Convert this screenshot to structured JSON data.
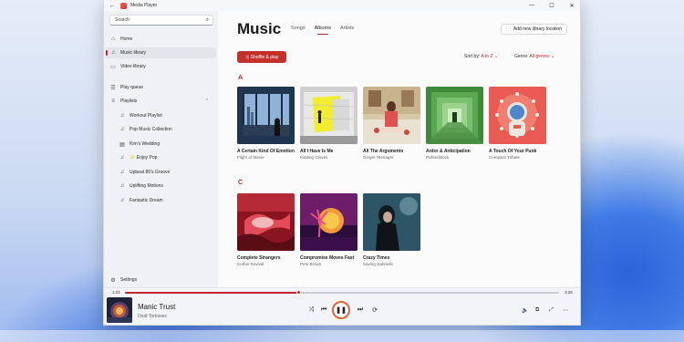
{
  "window": {
    "title": "Media Player",
    "back_icon": "back-arrow-icon",
    "controls": [
      "minimize",
      "maximize",
      "close"
    ]
  },
  "sidebar": {
    "search_placeholder": "Search",
    "items": [
      {
        "label": "Home",
        "icon": "home-icon"
      },
      {
        "label": "Music library",
        "icon": "music-library-icon"
      },
      {
        "label": "Video library",
        "icon": "video-library-icon"
      },
      {
        "label": "Play queue",
        "icon": "queue-icon"
      },
      {
        "label": "Playlists",
        "icon": "playlists-icon"
      }
    ],
    "playlists": [
      "Workout Playlist",
      "Pop Music Collection",
      "Kim's Wedding",
      "✨ Enjoy Pop",
      "Upbeat 80's Groove",
      "Uplifting Motions",
      "Fantastic Dream"
    ],
    "settings_label": "Settings"
  },
  "main": {
    "title": "Music",
    "tabs": [
      "Songs",
      "Albums",
      "Artists"
    ],
    "active_tab": "Albums",
    "add_library_label": "Add new library location",
    "shuffle_label": "Shuffle & play",
    "sort_label": "Sort by:",
    "sort_value": "A to Z",
    "genre_label": "Genre:",
    "genre_value": "All genres",
    "sections": [
      {
        "letter": "A",
        "albums": [
          {
            "title": "A Certain Kind Of Emotion",
            "artist": "Flight of Stevie"
          },
          {
            "title": "All I Have Is Me",
            "artist": "Kidding Gloves"
          },
          {
            "title": "All The Arguments",
            "artist": "Ginger Teenager"
          },
          {
            "title": "Ardor & Anticipation",
            "artist": "Pullsedstock"
          },
          {
            "title": "A Touch Of Your Punk",
            "artist": "Compass Tribute"
          }
        ]
      },
      {
        "letter": "C",
        "albums": [
          {
            "title": "Complete Strangers",
            "artist": "Corbin Revival"
          },
          {
            "title": "Compromise Moves Fast",
            "artist": "Pete Brown"
          },
          {
            "title": "Crazy Times",
            "artist": "Saving Gabrielle"
          }
        ]
      }
    ]
  },
  "player": {
    "elapsed": "1:24",
    "duration": "3:28",
    "progress": 0.4,
    "track_title": "Manic Trust",
    "track_artist": "Deaf Tortoises"
  },
  "colors": {
    "accent": "#c4262e",
    "play_ring": "#e0633a"
  }
}
